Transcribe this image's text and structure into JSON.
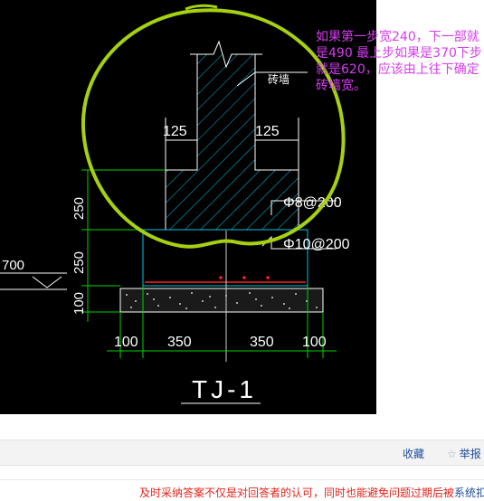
{
  "drawing": {
    "title": "TJ-1",
    "labels": {
      "brick_wall": "砖墙",
      "rebar_top": "Φ8@200",
      "rebar_bottom": "Φ10@200",
      "level": "700"
    },
    "dims_horizontal": [
      "125",
      "125"
    ],
    "dims_bottom": [
      "100",
      "350",
      "350",
      "100"
    ],
    "dims_vertical": [
      "250",
      "250",
      "100"
    ]
  },
  "annotation": {
    "note": "如果第一步宽240，下一部就是490 最上步如果是370下步就是620，应该由上往下确定砖墙宽。",
    "note_color": "#d63cf0",
    "circle_color": "#a6d10f"
  },
  "actions": {
    "collect": "收藏",
    "report": "举报"
  },
  "tip": {
    "text": "及时采纳答案不仅是对回答者的认可，同时也能避免问题过期后被",
    "tail": "系统扣"
  }
}
